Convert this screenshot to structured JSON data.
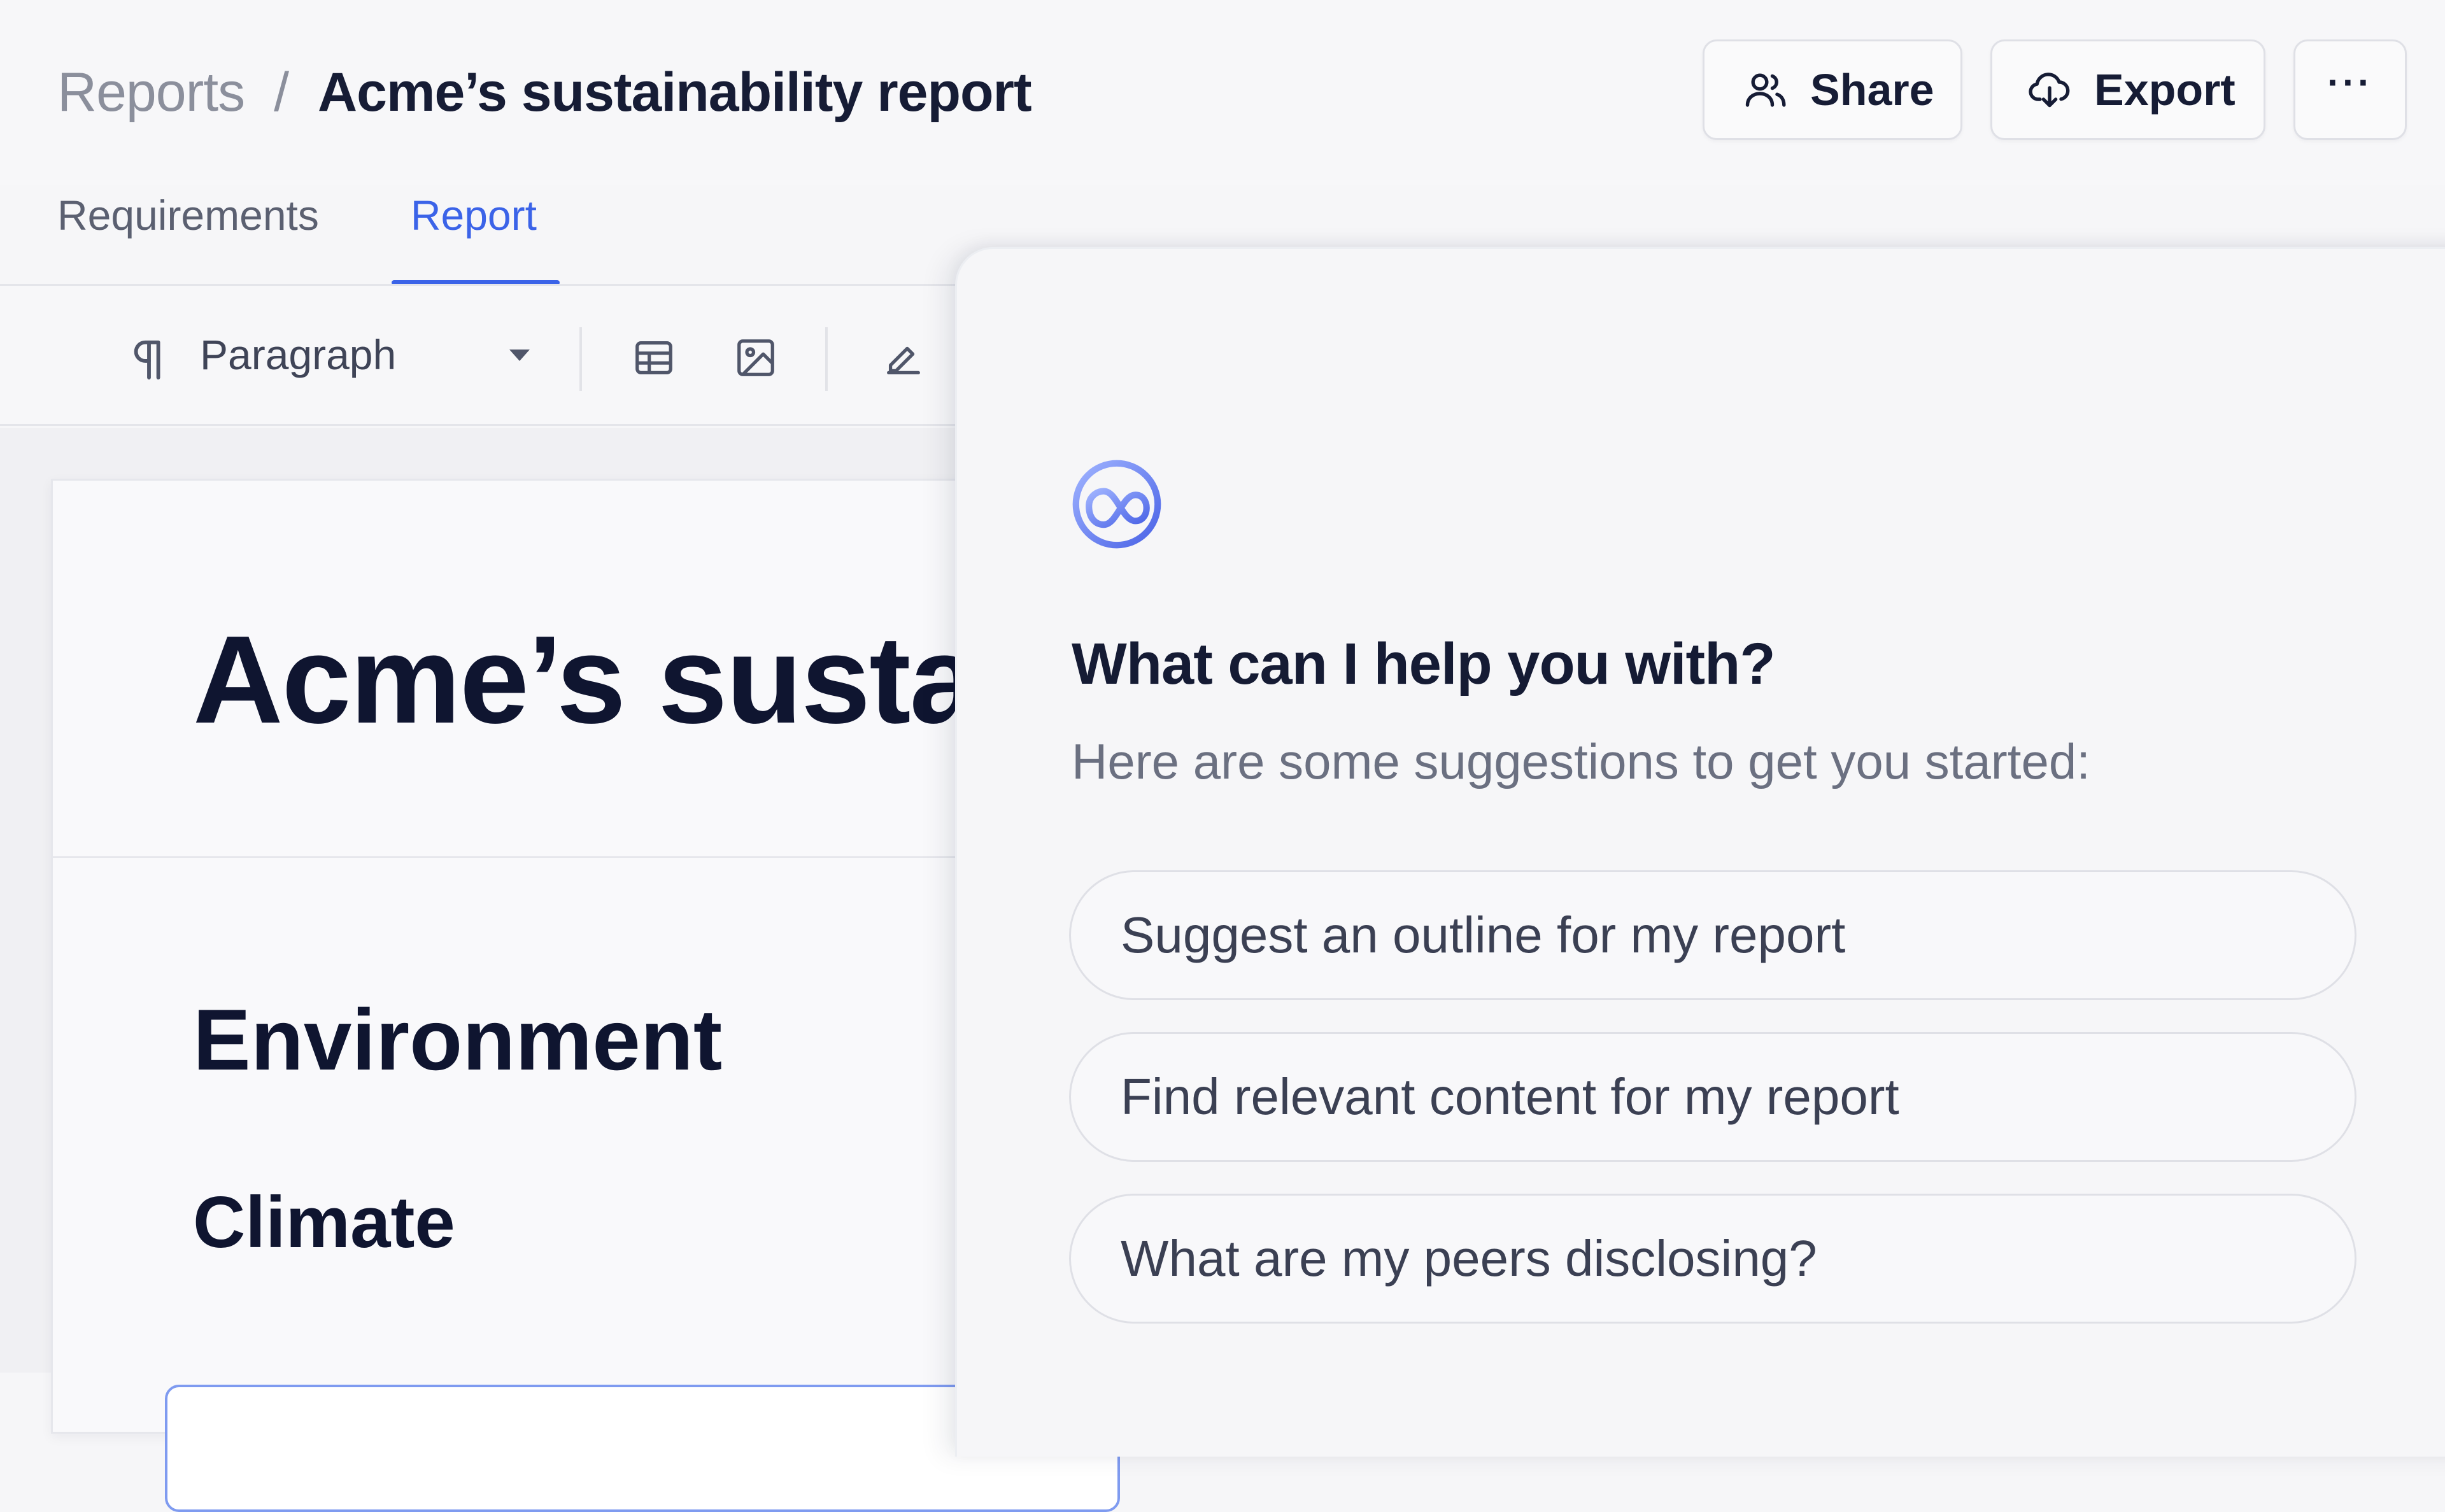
{
  "breadcrumb": {
    "root": "Reports",
    "separator": "/",
    "current": "Acme’s sustainability report"
  },
  "actions": {
    "share_label": "Share",
    "export_label": "Export",
    "more_label": "···"
  },
  "tabs": [
    {
      "label": "Requirements",
      "active": false
    },
    {
      "label": "Report",
      "active": true
    }
  ],
  "toolbar": {
    "block_style": "Paragraph",
    "icons": [
      "paragraph-icon",
      "table-icon",
      "image-icon",
      "signature-icon"
    ]
  },
  "document": {
    "title": "Acme’s sustainability report",
    "sections": [
      {
        "heading": "Environment"
      },
      {
        "heading": "Climate"
      }
    ]
  },
  "assistant": {
    "heading": "What can I help you with?",
    "subheading": "Here are some suggestions to get you started:",
    "suggestions": [
      "Suggest an outline for my report",
      "Find relevant content for my report",
      "What are my peers disclosing?"
    ]
  },
  "colors": {
    "accent": "#3b63e8",
    "text": "#141a33",
    "muted": "#8b8f9c"
  }
}
